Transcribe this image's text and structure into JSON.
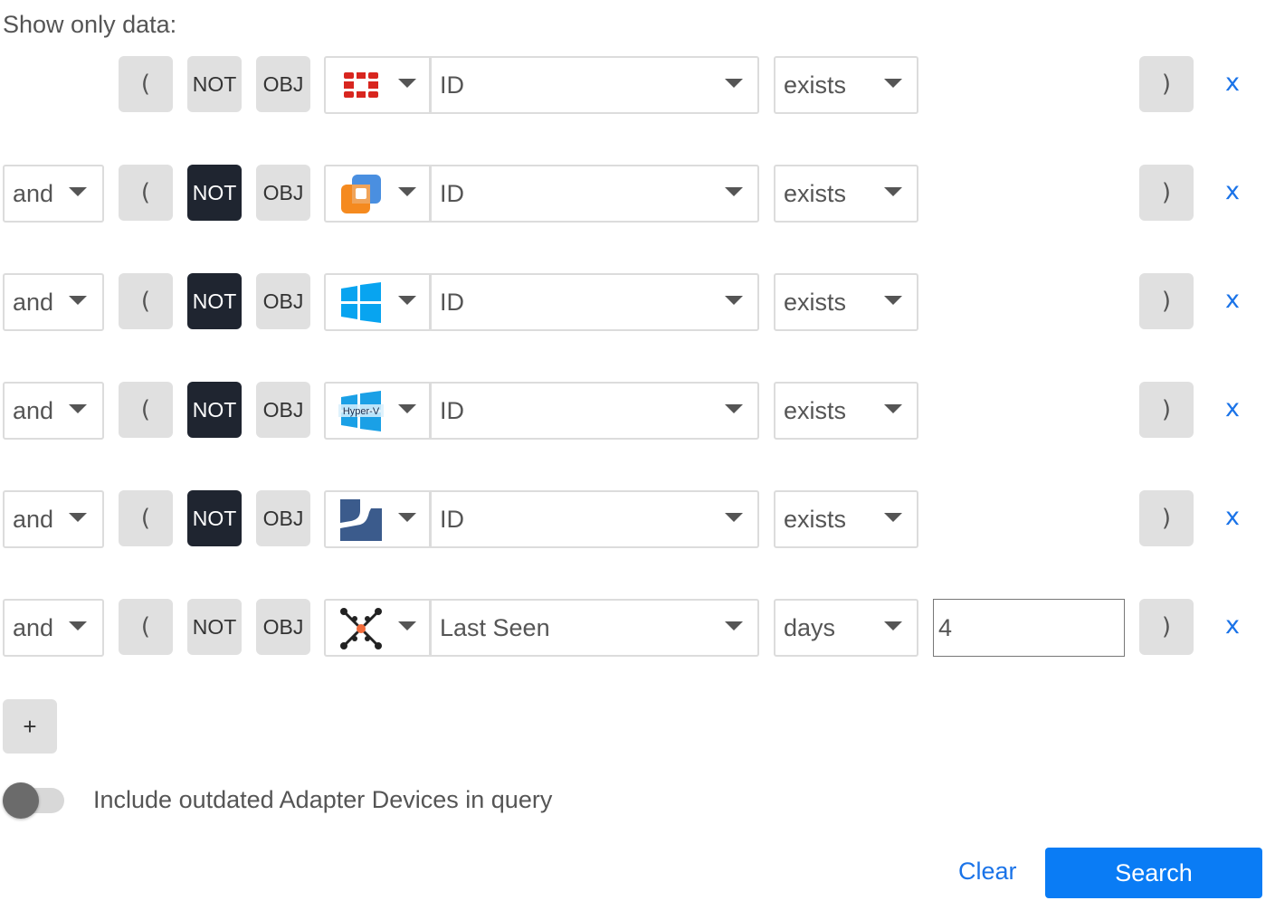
{
  "header": {
    "title": "Show only data:"
  },
  "rows": [
    {
      "logic": "",
      "open_paren": "(",
      "not_label": "NOT",
      "not_active": false,
      "obj_label": "OBJ",
      "adapter_icon": "fortinet-icon",
      "field": "ID",
      "operator": "exists",
      "value": null,
      "close_paren": ")",
      "remove_label": "x"
    },
    {
      "logic": "and",
      "open_paren": "(",
      "not_label": "NOT",
      "not_active": true,
      "obj_label": "OBJ",
      "adapter_icon": "vmware-icon",
      "field": "ID",
      "operator": "exists",
      "value": null,
      "close_paren": ")",
      "remove_label": "x"
    },
    {
      "logic": "and",
      "open_paren": "(",
      "not_label": "NOT",
      "not_active": true,
      "obj_label": "OBJ",
      "adapter_icon": "windows-icon",
      "field": "ID",
      "operator": "exists",
      "value": null,
      "close_paren": ")",
      "remove_label": "x"
    },
    {
      "logic": "and",
      "open_paren": "(",
      "not_label": "NOT",
      "not_active": true,
      "obj_label": "OBJ",
      "adapter_icon": "hyperv-icon",
      "hyperv_text": "Hyper-V",
      "field": "ID",
      "operator": "exists",
      "value": null,
      "close_paren": ")",
      "remove_label": "x"
    },
    {
      "logic": "and",
      "open_paren": "(",
      "not_label": "NOT",
      "not_active": true,
      "obj_label": "OBJ",
      "adapter_icon": "adapter-s-icon",
      "field": "ID",
      "operator": "exists",
      "value": null,
      "close_paren": ")",
      "remove_label": "x"
    },
    {
      "logic": "and",
      "open_paren": "(",
      "not_label": "NOT",
      "not_active": false,
      "obj_label": "OBJ",
      "adapter_icon": "aggregated-adapters-icon",
      "field": "Last Seen",
      "operator": "days",
      "value": "4",
      "close_paren": ")",
      "remove_label": "x"
    }
  ],
  "add_label": "+",
  "toggle": {
    "label": "Include outdated Adapter Devices in query",
    "on": false
  },
  "actions": {
    "clear_label": "Clear",
    "search_label": "Search"
  },
  "colors": {
    "accent": "#0a7cf5",
    "link": "#1a73e8",
    "not_active_bg": "#1f2530"
  }
}
